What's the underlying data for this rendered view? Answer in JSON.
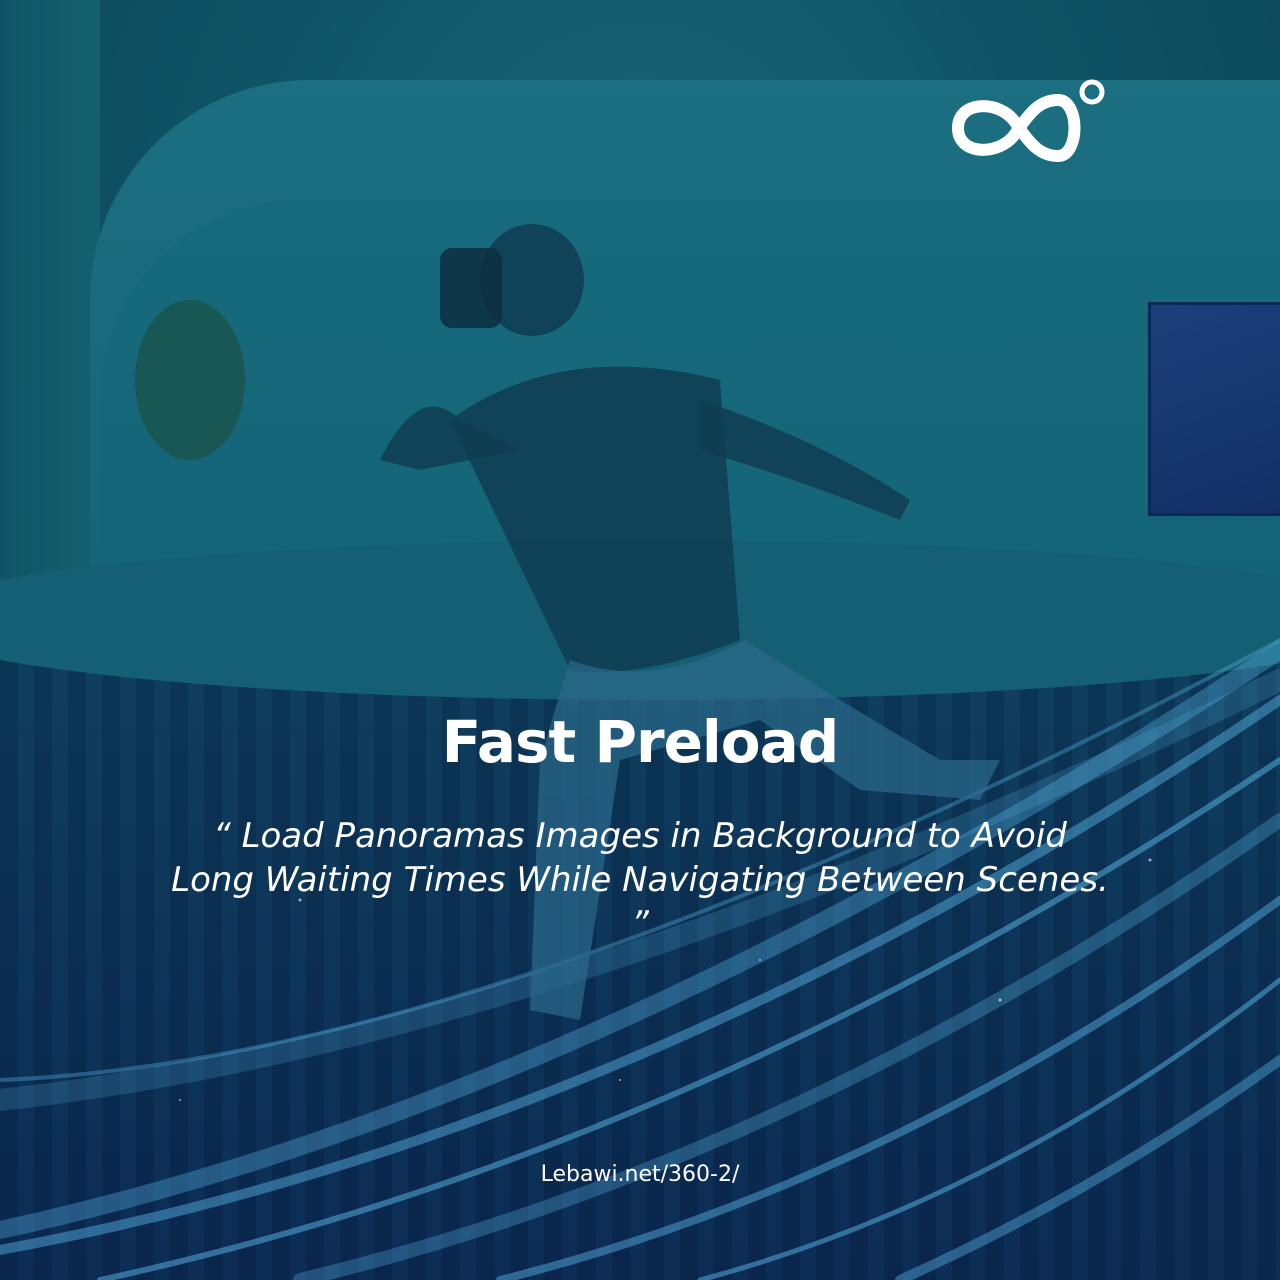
{
  "poster": {
    "title": "Fast Preload",
    "quote": "“ Load Panoramas Images in Background to Avoid Long Waiting Times While Navigating Between Scenes. ”",
    "url": "Lebawi.net/360-2/"
  },
  "brand": {
    "logo_icon": "infinity-degree-icon"
  },
  "colors": {
    "background": "#0f5567",
    "text": "#ffffff",
    "streak": "#5ab8e8"
  }
}
